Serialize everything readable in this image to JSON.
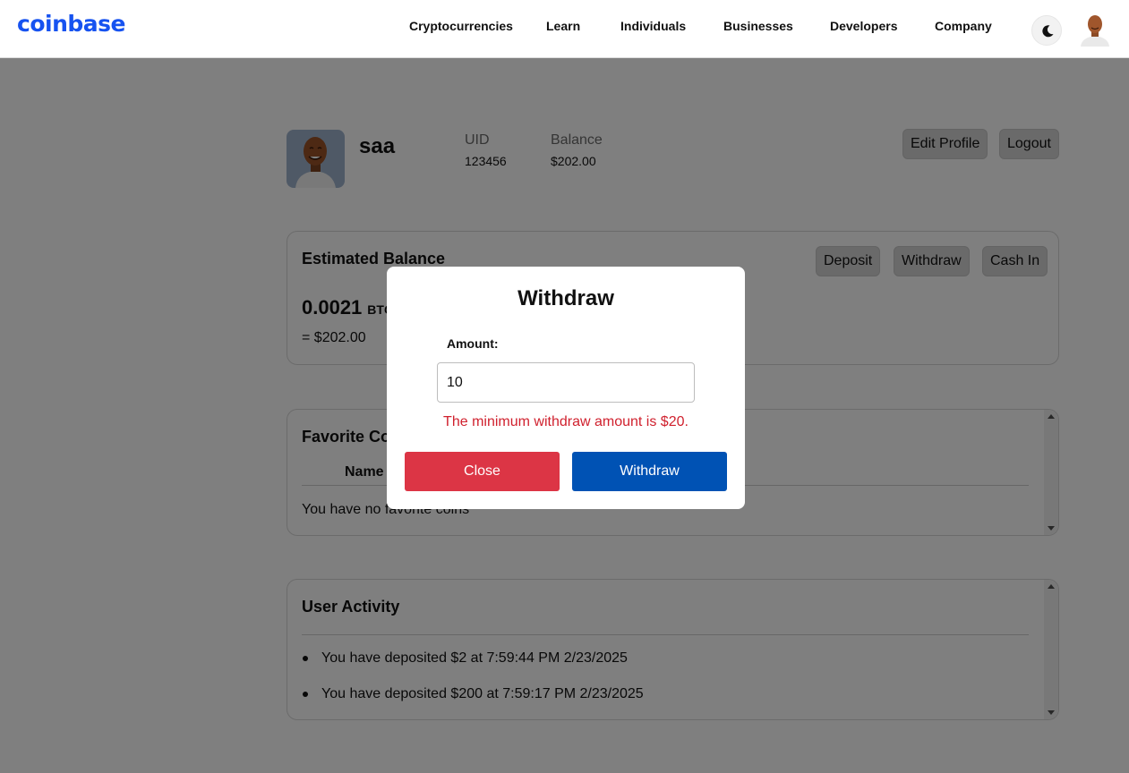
{
  "header": {
    "logo": "coinbase",
    "nav": [
      "Cryptocurrencies",
      "Learn",
      "Individuals",
      "Businesses",
      "Developers",
      "Company"
    ]
  },
  "profile": {
    "name": "saa",
    "uid_label": "UID",
    "uid_value": "123456",
    "balance_label": "Balance",
    "balance_value": "$202.00",
    "edit_profile": "Edit Profile",
    "logout": "Logout"
  },
  "estimated_balance": {
    "title": "Estimated Balance",
    "btc_amount": "0.0021",
    "btc_unit": "BTC",
    "usd_equivalent": "= $202.00",
    "deposit": "Deposit",
    "withdraw": "Withdraw",
    "cash_in": "Cash In"
  },
  "favorites": {
    "title": "Favorite Coins",
    "column_name": "Name",
    "empty": "You have no favorite coins"
  },
  "activity": {
    "title": "User Activity",
    "items": [
      "You have deposited $2 at 7:59:44 PM 2/23/2025",
      "You have deposited $200 at 7:59:17 PM 2/23/2025"
    ]
  },
  "modal": {
    "title": "Withdraw",
    "amount_label": "Amount:",
    "amount_value": "10",
    "error": "The minimum withdraw amount is $20.",
    "close": "Close",
    "withdraw": "Withdraw"
  },
  "icons": {
    "theme": "moon-icon",
    "avatar": "avatar-icon"
  },
  "colors": {
    "brand": "#1652f0",
    "danger": "#dc3545",
    "primary": "#0052b4",
    "error_text": "#d0212e"
  }
}
